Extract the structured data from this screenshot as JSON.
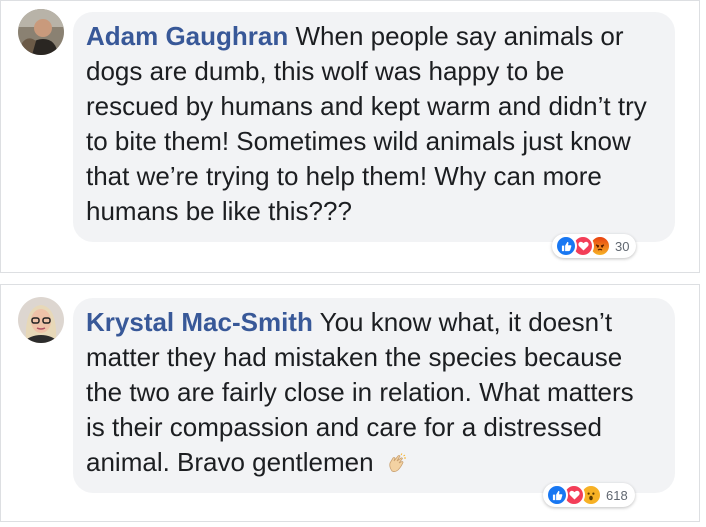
{
  "comments": [
    {
      "author": "Adam Gaughran",
      "text": "When people say animals or dogs are dumb, this wolf was happy to be rescued by humans and kept warm and didn’t try to bite them! Sometimes wild animals just know that we’re trying to help them! Why can more humans be like this???",
      "reactions": [
        "like-icon",
        "love-icon",
        "angry-icon"
      ],
      "reaction_count": "30",
      "colors": {
        "like": "#1877f2",
        "love": "#f33e58",
        "angry": "#e9710f"
      }
    },
    {
      "author": "Krystal Mac-Smith",
      "text": "You know what, it doesn’t matter they had mistaken the species because the two are fairly close in relation. What matters is their compassion and care for a distressed animal. Bravo gentlemen",
      "trailing_emoji": "clapping-hands-icon",
      "reactions": [
        "like-icon",
        "love-icon",
        "wow-icon"
      ],
      "reaction_count": "618",
      "colors": {
        "like": "#1877f2",
        "love": "#f33e58",
        "wow": "#f7b125"
      }
    }
  ],
  "theme": {
    "author_color": "#385898",
    "bubble_bg": "#f2f3f5",
    "text_color": "#1c1e21"
  }
}
